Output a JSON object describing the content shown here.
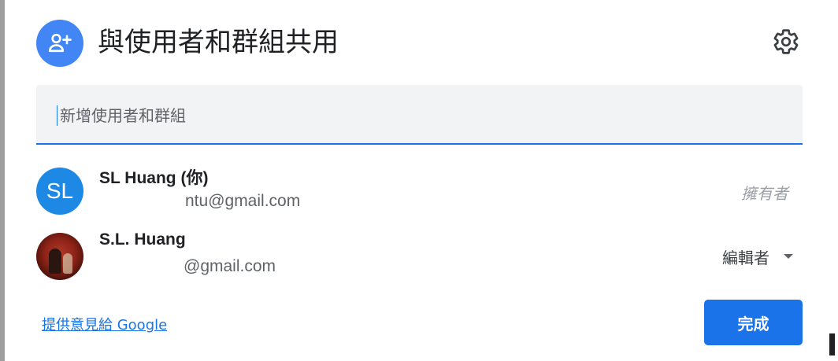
{
  "dialog": {
    "title": "與使用者和群組共用"
  },
  "colors": {
    "accent": "#1a73e8",
    "avatar_blue": "#1e88e5",
    "header_icon_bg": "#4285f4"
  },
  "icons": {
    "header": "person-add-icon",
    "settings": "gear-icon",
    "dropdown": "arrow-drop-down-icon"
  },
  "search": {
    "placeholder": "新增使用者和群組",
    "value": ""
  },
  "users": [
    {
      "avatar_initials": "SL",
      "name": "SL Huang (你)",
      "email": "ntu@gmail.com",
      "role": "擁有者"
    },
    {
      "name": "S.L. Huang",
      "email": "@gmail.com",
      "role": "編輯者"
    }
  ],
  "footer": {
    "feedback_link": "提供意見給 Google",
    "done_label": "完成"
  }
}
